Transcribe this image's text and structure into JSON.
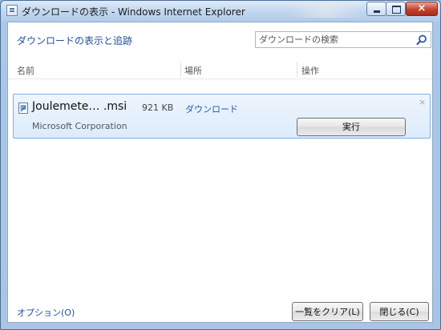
{
  "window": {
    "title": "ダウンロードの表示 - Windows Internet Explorer",
    "controls": {
      "minimize": "minimize",
      "maximize": "maximize",
      "close": "×"
    }
  },
  "header": {
    "link": "ダウンロードの表示と追跡"
  },
  "search": {
    "placeholder": "ダウンロードの検索"
  },
  "columns": {
    "name": "名前",
    "location": "場所",
    "action": "操作"
  },
  "downloads": [
    {
      "name": "Joulemete… .msi",
      "size": "921 KB",
      "location": "ダウンロード",
      "publisher": "Microsoft Corporation",
      "action": "実行",
      "dismiss": "×"
    }
  ],
  "footer": {
    "options_link": "オプション(O)",
    "clear_button": "一覧をクリア(L)",
    "close_button": "閉じる(C)"
  },
  "colors": {
    "accent": "#1f4f9a",
    "item_border": "#84acdd",
    "item_bg": "#dcebfc"
  },
  "icons": {
    "title": "download-window-icon",
    "search": "search-icon",
    "file": "file-icon"
  }
}
